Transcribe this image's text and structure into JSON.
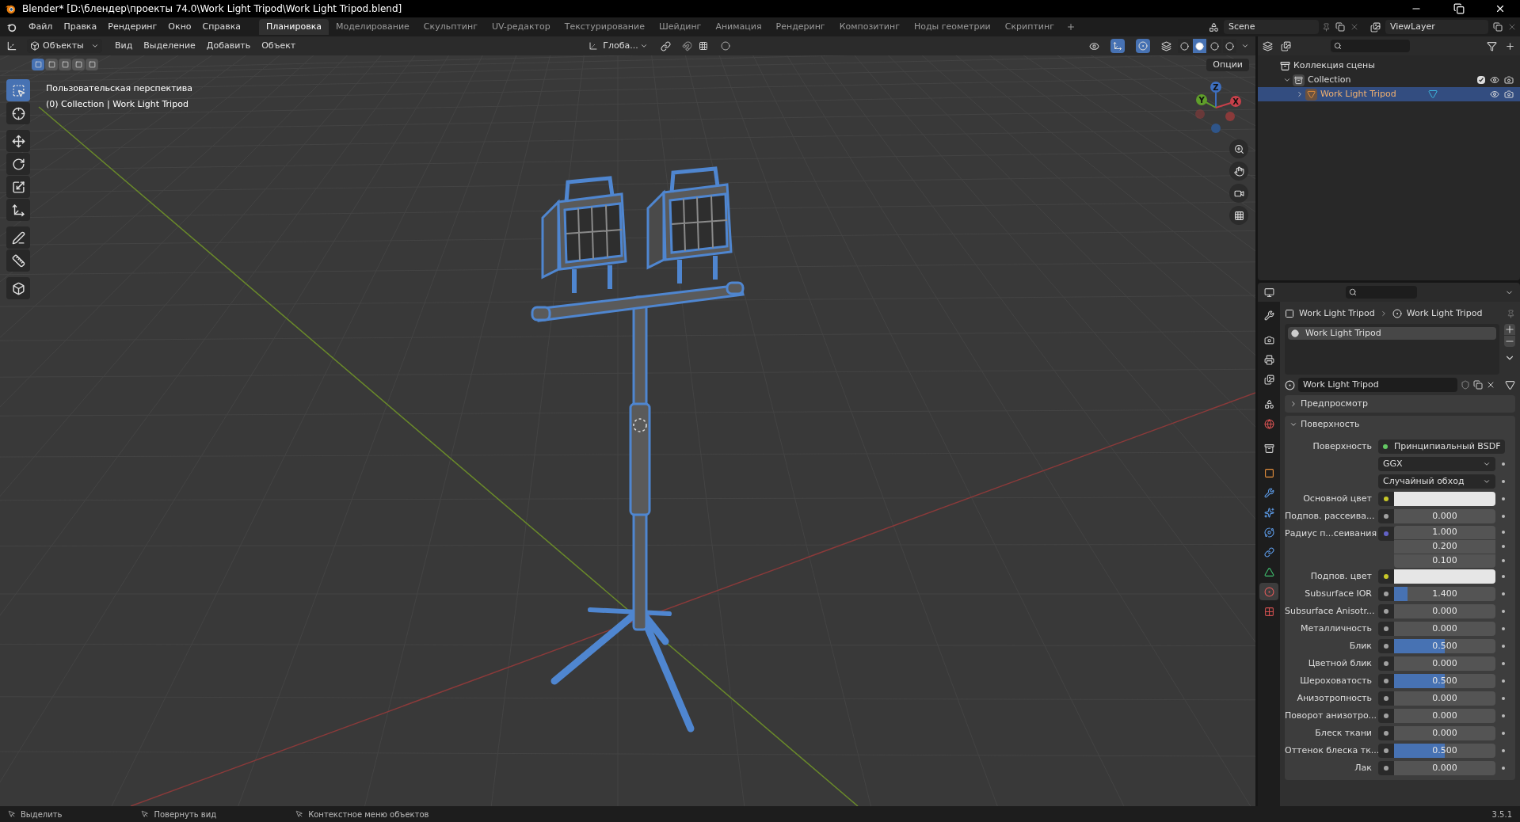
{
  "window": {
    "title": "Blender* [D:\\блендер\\проекты 74.0\\Work Light Tripod\\Work Light Tripod.blend]"
  },
  "menu_bar": [
    "Файл",
    "Правка",
    "Рендеринг",
    "Окно",
    "Справка"
  ],
  "workspaces": [
    {
      "label": "Планировка",
      "selected": true
    },
    {
      "label": "Моделирование",
      "selected": false
    },
    {
      "label": "Скульптинг",
      "selected": false
    },
    {
      "label": "UV-редактор",
      "selected": false
    },
    {
      "label": "Текстурирование",
      "selected": false
    },
    {
      "label": "Шейдинг",
      "selected": false
    },
    {
      "label": "Анимация",
      "selected": false
    },
    {
      "label": "Рендеринг",
      "selected": false
    },
    {
      "label": "Композитинг",
      "selected": false
    },
    {
      "label": "Ноды геометрии",
      "selected": false
    },
    {
      "label": "Скриптинг",
      "selected": false
    }
  ],
  "scene": "Scene",
  "view_layer": "ViewLayer",
  "viewport": {
    "mode": "Объекты",
    "menus": [
      "Вид",
      "Выделение",
      "Добавить",
      "Объект"
    ],
    "orientation": "Глоба...",
    "options": "Опции",
    "select_modes": [
      {
        "selected": true
      },
      {
        "selected": false
      },
      {
        "selected": false
      },
      {
        "selected": false
      },
      {
        "selected": false
      }
    ],
    "overlay": [
      "Пользовательская перспектива",
      "(0) Collection | Work Light Tripod"
    ],
    "tools": [
      {
        "kind": "select",
        "selected": true
      },
      {
        "kind": "cursor",
        "selected": false
      },
      {
        "kind": "move",
        "selected": false
      },
      {
        "kind": "rotate",
        "selected": false
      },
      {
        "kind": "scale",
        "selected": false
      },
      {
        "kind": "transform",
        "selected": false
      },
      {
        "kind": "annotate",
        "selected": false
      },
      {
        "kind": "measure",
        "selected": false
      },
      {
        "kind": "add_cube",
        "selected": false
      }
    ],
    "gizmo_axes": [
      "Z",
      "Y",
      "X"
    ],
    "shading": [
      {
        "selected": false
      },
      {
        "selected": true
      },
      {
        "selected": false
      },
      {
        "selected": false
      }
    ]
  },
  "outliner": {
    "items": [
      {
        "kind": "scene_collection",
        "label": "Коллекция сцены",
        "children": [
          {
            "kind": "collection",
            "label": "Collection",
            "expanded": true,
            "checked": true,
            "children": [
              {
                "kind": "object",
                "label": "Work Light Tripod",
                "expanded": false,
                "selected": true
              }
            ]
          }
        ]
      }
    ]
  },
  "properties": {
    "tabs": [
      {
        "kind": "tool",
        "selected": false
      },
      {
        "kind": "render",
        "selected": false
      },
      {
        "kind": "output",
        "selected": false
      },
      {
        "kind": "view_layer",
        "selected": false
      },
      {
        "kind": "scene",
        "selected": false
      },
      {
        "kind": "world",
        "selected": false
      },
      {
        "kind": "collection",
        "selected": false
      },
      {
        "kind": "object",
        "selected": false
      },
      {
        "kind": "modifiers",
        "selected": false
      },
      {
        "kind": "particles",
        "selected": false
      },
      {
        "kind": "physics",
        "selected": false
      },
      {
        "kind": "constraints",
        "selected": false
      },
      {
        "kind": "data",
        "selected": false
      },
      {
        "kind": "material",
        "selected": true
      },
      {
        "kind": "texture",
        "selected": false
      }
    ],
    "breadcrumb": [
      "Work Light Tripod",
      "Work Light Tripod"
    ],
    "slots": [
      {
        "label": "Work Light Tripod",
        "selected": true
      }
    ],
    "material": "Work Light Tripod",
    "panels": [
      {
        "label": "Предпросмотр",
        "expanded": false
      },
      {
        "label": "Поверхность",
        "expanded": true
      }
    ],
    "fields": [
      {
        "kind": "shader",
        "label": "Поверхность",
        "value": "Принципиальный BSDF",
        "color": "#63c763"
      },
      {
        "kind": "dropdown",
        "value": "GGX"
      },
      {
        "kind": "dropdown",
        "value": "Случайный обход"
      },
      {
        "kind": "color",
        "label": "Основной цвет",
        "color": "#c7c729"
      },
      {
        "kind": "number",
        "label": "Подпов. рассеива...",
        "value": "0.000",
        "color": "#a1a1a1"
      },
      {
        "kind": "vector",
        "label": "Радиус п...сеивания",
        "values": [
          "1.000",
          "0.200",
          "0.100"
        ],
        "color": "#6363c7"
      },
      {
        "kind": "color",
        "label": "Подпов. цвет",
        "color": "#c7c729"
      },
      {
        "kind": "slider",
        "label": "Subsurface IOR",
        "value": "1.400",
        "level": 0.13,
        "color": "#a1a1a1"
      },
      {
        "kind": "number",
        "label": "Subsurface Anisotr...",
        "value": "0.000",
        "color": "#a1a1a1"
      },
      {
        "kind": "number",
        "label": "Металличность",
        "value": "0.000",
        "color": "#a1a1a1"
      },
      {
        "kind": "slider",
        "label": "Блик",
        "value": "0.500",
        "level": 0.5,
        "color": "#a1a1a1"
      },
      {
        "kind": "number",
        "label": "Цветной блик",
        "value": "0.000",
        "color": "#a1a1a1"
      },
      {
        "kind": "slider",
        "label": "Шероховатость",
        "value": "0.500",
        "level": 0.5,
        "color": "#a1a1a1"
      },
      {
        "kind": "number",
        "label": "Анизотропность",
        "value": "0.000",
        "color": "#a1a1a1"
      },
      {
        "kind": "number",
        "label": "Поворот анизотро...",
        "value": "0.000",
        "color": "#a1a1a1"
      },
      {
        "kind": "number",
        "label": "Блеск ткани",
        "value": "0.000",
        "color": "#a1a1a1"
      },
      {
        "kind": "slider",
        "label": "Оттенок блеска тк...",
        "value": "0.500",
        "level": 0.5,
        "color": "#a1a1a1"
      },
      {
        "kind": "number",
        "label": "Лак",
        "value": "0.000",
        "color": "#a1a1a1"
      }
    ]
  },
  "status_bar": {
    "hints": [
      "Выделить",
      "Повернуть вид",
      "Контекстное меню объектов"
    ],
    "version": "3.5.1"
  }
}
